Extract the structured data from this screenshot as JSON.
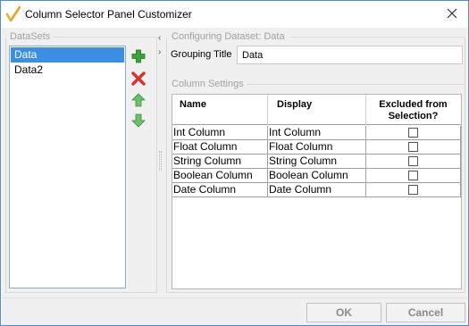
{
  "window": {
    "title": "Column Selector Panel Customizer"
  },
  "datasets": {
    "label": "DataSets",
    "items": [
      {
        "label": "Data",
        "selected": true
      },
      {
        "label": "Data2",
        "selected": false
      }
    ]
  },
  "toolbar": [
    "add-icon",
    "delete-icon",
    "move-up-icon",
    "move-down-icon"
  ],
  "config": {
    "label": "Configuring Dataset: Data",
    "grouping_title_label": "Grouping Title",
    "grouping_title_value": "Data",
    "column_settings_label": "Column Settings",
    "columns": {
      "name": "Name",
      "display": "Display",
      "excluded_line1": "Excluded from",
      "excluded_line2": "Selection?"
    },
    "rows": [
      {
        "name": "Int Column",
        "display": "Int Column",
        "excluded": false
      },
      {
        "name": "Float Column",
        "display": "Float Column",
        "excluded": false
      },
      {
        "name": "String Column",
        "display": "String Column",
        "excluded": false
      },
      {
        "name": "Boolean Column",
        "display": "Boolean Column",
        "excluded": false
      },
      {
        "name": "Date Column",
        "display": "Date Column",
        "excluded": false
      }
    ]
  },
  "buttons": {
    "ok": "OK",
    "cancel": "Cancel"
  },
  "colors": {
    "accent": "#3c8ee2",
    "add": "#3aa33a",
    "delete": "#d93030",
    "arrows": "#5cb85c"
  }
}
